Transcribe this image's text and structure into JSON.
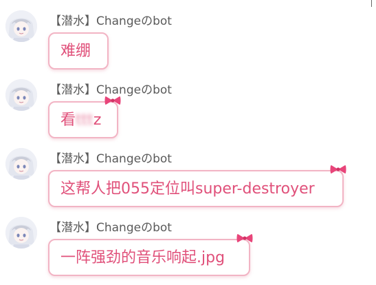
{
  "colors": {
    "bubble_border": "#f2b4c4",
    "bubble_text": "#e0507a",
    "sender_text": "#5a5a5a",
    "bow": "#e8457a"
  },
  "messages": [
    {
      "sender": "【潜水】Changeのbot",
      "text": "难绷",
      "avatar": "anime-girl-avatar"
    },
    {
      "sender": "【潜水】Changeのbot",
      "text_visible_prefix": "看",
      "text_redacted": "ttt",
      "text_visible_suffix": "z",
      "avatar": "anime-girl-avatar"
    },
    {
      "sender": "【潜水】Changeのbot",
      "text": "这帮人把055定位叫super-destroyer",
      "avatar": "anime-girl-avatar"
    },
    {
      "sender": "【潜水】Changeのbot",
      "text": "一阵强劲的音乐响起.jpg",
      "avatar": "anime-girl-avatar"
    }
  ]
}
